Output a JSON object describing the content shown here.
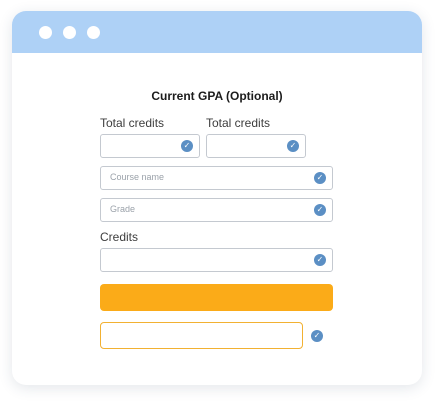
{
  "form": {
    "title": "Current GPA (Optional)",
    "total_credits_label_1": "Total credits",
    "total_credits_label_2": "Total credits",
    "course_name_placeholder": "Course name",
    "grade_placeholder": "Grade",
    "credits_label": "Credits",
    "submit_label": "",
    "result_value": ""
  },
  "icons": {
    "check": "✓",
    "check_name": "check-circle-icon"
  },
  "colors": {
    "titlebar": "#aed1f6",
    "accent": "#fbab18",
    "check": "#5b8fc4",
    "result_border": "#f2b132"
  }
}
